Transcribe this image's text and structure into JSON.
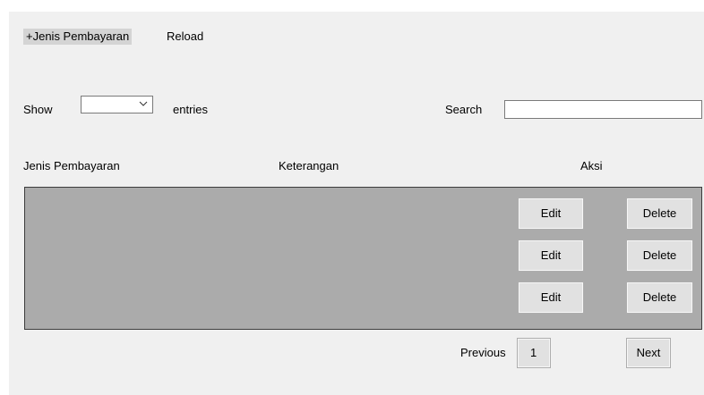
{
  "toolbar": {
    "add_label": "+Jenis Pembayaran",
    "reload_label": "Reload"
  },
  "entries": {
    "show_label": "Show",
    "selected_value": "",
    "suffix_label": "entries"
  },
  "search": {
    "label": "Search",
    "value": ""
  },
  "table": {
    "columns": [
      "Jenis Pembayaran",
      "Keterangan",
      "Aksi"
    ],
    "rows": [
      {
        "edit_label": "Edit",
        "delete_label": "Delete"
      },
      {
        "edit_label": "Edit",
        "delete_label": "Delete"
      },
      {
        "edit_label": "Edit",
        "delete_label": "Delete"
      }
    ]
  },
  "pagination": {
    "previous_label": "Previous",
    "current_page": "1",
    "next_label": "Next"
  },
  "colors": {
    "window_bg": "#f0f0f0",
    "grid_bg": "#ababab",
    "button_bg": "#e1e1e1",
    "highlight_bg": "#d4d4d4"
  }
}
